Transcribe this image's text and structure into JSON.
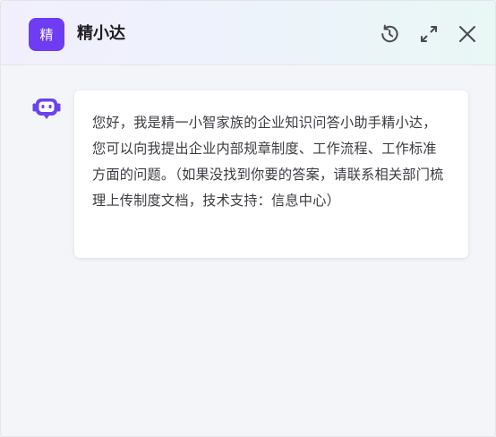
{
  "header": {
    "badge_char": "精",
    "title": "精小达",
    "accent_color": "#6e3cf2",
    "icons": {
      "history": "history-icon",
      "expand": "expand-icon",
      "close": "close-icon"
    }
  },
  "chat": {
    "messages": [
      {
        "sender": "bot",
        "avatar_icon": "robot-icon",
        "text": "您好，我是精一小智家族的企业知识问答小助手精小达，您可以向我提出企业内部规章制度、工作流程、工作标准方面的问题。（如果没找到你要的答案，请联系相关部门梳理上传制度文档，技术支持：信息中心）"
      }
    ]
  }
}
